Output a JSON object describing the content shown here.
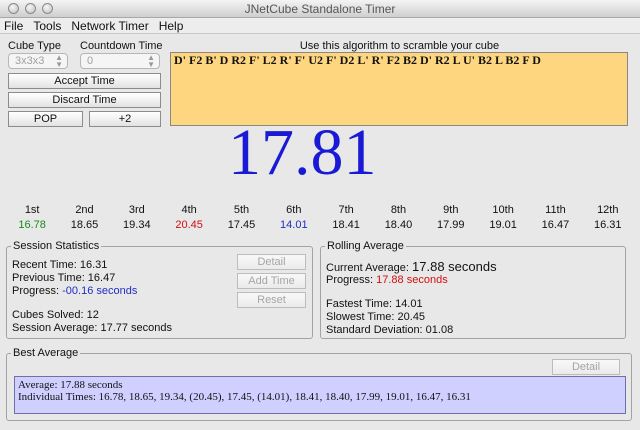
{
  "window": {
    "title": "JNetCube Standalone Timer"
  },
  "menu": [
    "File",
    "Tools",
    "Network Timer",
    "Help"
  ],
  "controls": {
    "cube_type_label": "Cube Type",
    "cube_type_value": "3x3x3",
    "countdown_label": "Countdown Time",
    "countdown_value": "0",
    "accept_label": "Accept Time",
    "discard_label": "Discard Time",
    "pop_label": "POP",
    "plus2_label": "+2"
  },
  "scramble": {
    "heading": "Use this algorithm to scramble your cube",
    "text": "D' F2 B' D R2 F' L2 R' F' U2 F' D2 L' R' F2 B2 D' R2 L U' B2 L B2 F D"
  },
  "timer": {
    "display": "17.81"
  },
  "history": {
    "labels": [
      "1st",
      "2nd",
      "3rd",
      "4th",
      "5th",
      "6th",
      "7th",
      "8th",
      "9th",
      "10th",
      "11th",
      "12th"
    ],
    "values": [
      "16.78",
      "18.65",
      "19.34",
      "20.45",
      "17.45",
      "14.01",
      "18.41",
      "18.40",
      "17.99",
      "19.01",
      "16.47",
      "16.31"
    ],
    "colors": [
      "#1a8a1a",
      "#111111",
      "#111111",
      "#d01010",
      "#111111",
      "#1f2fc0",
      "#111111",
      "#111111",
      "#111111",
      "#111111",
      "#111111",
      "#111111"
    ]
  },
  "session": {
    "title": "Session Statistics",
    "recent": "Recent Time: 16.31",
    "previous": "Previous Time: 16.47",
    "progress_label": "Progress:",
    "progress_value": "-00.16 seconds",
    "solved": "Cubes Solved: 12",
    "average": "Session Average: 17.77 seconds",
    "detail_label": "Detail",
    "add_time_label": "Add Time",
    "reset_label": "Reset"
  },
  "rolling": {
    "title": "Rolling Average",
    "current_label": "Current Average:",
    "current_value": "17.88 seconds",
    "progress_label": "Progress:",
    "progress_value": "17.88 seconds",
    "fastest": "Fastest Time: 14.01",
    "slowest": "Slowest Time: 20.45",
    "stddev": "Standard Deviation: 01.08"
  },
  "best": {
    "title": "Best Average",
    "detail_label": "Detail",
    "average_line": "Average: 17.88 seconds",
    "times_line": "Individual Times: 16.78, 18.65, 19.34, (20.45), 17.45, (14.01), 18.41, 18.40, 17.99, 19.01, 16.47, 16.31"
  },
  "colors": {
    "accent_blue": "#1a1ad6",
    "scramble_bg": "#fed67f",
    "best_bg": "#cfd0ff",
    "progress_red": "#d01010",
    "progress_blue": "#1f2fc0"
  }
}
